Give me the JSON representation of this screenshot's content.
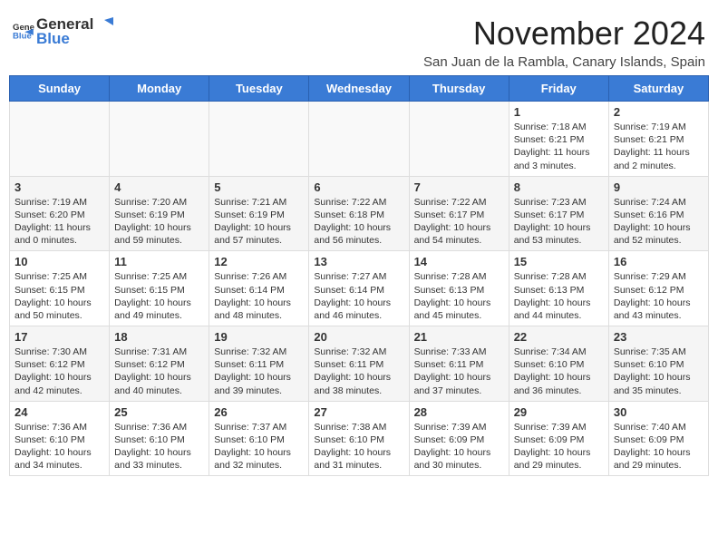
{
  "header": {
    "logo_general": "General",
    "logo_blue": "Blue",
    "month_title": "November 2024",
    "subtitle": "San Juan de la Rambla, Canary Islands, Spain"
  },
  "days_of_week": [
    "Sunday",
    "Monday",
    "Tuesday",
    "Wednesday",
    "Thursday",
    "Friday",
    "Saturday"
  ],
  "weeks": [
    [
      {
        "day": "",
        "info": ""
      },
      {
        "day": "",
        "info": ""
      },
      {
        "day": "",
        "info": ""
      },
      {
        "day": "",
        "info": ""
      },
      {
        "day": "",
        "info": ""
      },
      {
        "day": "1",
        "info": "Sunrise: 7:18 AM\nSunset: 6:21 PM\nDaylight: 11 hours and 3 minutes."
      },
      {
        "day": "2",
        "info": "Sunrise: 7:19 AM\nSunset: 6:21 PM\nDaylight: 11 hours and 2 minutes."
      }
    ],
    [
      {
        "day": "3",
        "info": "Sunrise: 7:19 AM\nSunset: 6:20 PM\nDaylight: 11 hours and 0 minutes."
      },
      {
        "day": "4",
        "info": "Sunrise: 7:20 AM\nSunset: 6:19 PM\nDaylight: 10 hours and 59 minutes."
      },
      {
        "day": "5",
        "info": "Sunrise: 7:21 AM\nSunset: 6:19 PM\nDaylight: 10 hours and 57 minutes."
      },
      {
        "day": "6",
        "info": "Sunrise: 7:22 AM\nSunset: 6:18 PM\nDaylight: 10 hours and 56 minutes."
      },
      {
        "day": "7",
        "info": "Sunrise: 7:22 AM\nSunset: 6:17 PM\nDaylight: 10 hours and 54 minutes."
      },
      {
        "day": "8",
        "info": "Sunrise: 7:23 AM\nSunset: 6:17 PM\nDaylight: 10 hours and 53 minutes."
      },
      {
        "day": "9",
        "info": "Sunrise: 7:24 AM\nSunset: 6:16 PM\nDaylight: 10 hours and 52 minutes."
      }
    ],
    [
      {
        "day": "10",
        "info": "Sunrise: 7:25 AM\nSunset: 6:15 PM\nDaylight: 10 hours and 50 minutes."
      },
      {
        "day": "11",
        "info": "Sunrise: 7:25 AM\nSunset: 6:15 PM\nDaylight: 10 hours and 49 minutes."
      },
      {
        "day": "12",
        "info": "Sunrise: 7:26 AM\nSunset: 6:14 PM\nDaylight: 10 hours and 48 minutes."
      },
      {
        "day": "13",
        "info": "Sunrise: 7:27 AM\nSunset: 6:14 PM\nDaylight: 10 hours and 46 minutes."
      },
      {
        "day": "14",
        "info": "Sunrise: 7:28 AM\nSunset: 6:13 PM\nDaylight: 10 hours and 45 minutes."
      },
      {
        "day": "15",
        "info": "Sunrise: 7:28 AM\nSunset: 6:13 PM\nDaylight: 10 hours and 44 minutes."
      },
      {
        "day": "16",
        "info": "Sunrise: 7:29 AM\nSunset: 6:12 PM\nDaylight: 10 hours and 43 minutes."
      }
    ],
    [
      {
        "day": "17",
        "info": "Sunrise: 7:30 AM\nSunset: 6:12 PM\nDaylight: 10 hours and 42 minutes."
      },
      {
        "day": "18",
        "info": "Sunrise: 7:31 AM\nSunset: 6:12 PM\nDaylight: 10 hours and 40 minutes."
      },
      {
        "day": "19",
        "info": "Sunrise: 7:32 AM\nSunset: 6:11 PM\nDaylight: 10 hours and 39 minutes."
      },
      {
        "day": "20",
        "info": "Sunrise: 7:32 AM\nSunset: 6:11 PM\nDaylight: 10 hours and 38 minutes."
      },
      {
        "day": "21",
        "info": "Sunrise: 7:33 AM\nSunset: 6:11 PM\nDaylight: 10 hours and 37 minutes."
      },
      {
        "day": "22",
        "info": "Sunrise: 7:34 AM\nSunset: 6:10 PM\nDaylight: 10 hours and 36 minutes."
      },
      {
        "day": "23",
        "info": "Sunrise: 7:35 AM\nSunset: 6:10 PM\nDaylight: 10 hours and 35 minutes."
      }
    ],
    [
      {
        "day": "24",
        "info": "Sunrise: 7:36 AM\nSunset: 6:10 PM\nDaylight: 10 hours and 34 minutes."
      },
      {
        "day": "25",
        "info": "Sunrise: 7:36 AM\nSunset: 6:10 PM\nDaylight: 10 hours and 33 minutes."
      },
      {
        "day": "26",
        "info": "Sunrise: 7:37 AM\nSunset: 6:10 PM\nDaylight: 10 hours and 32 minutes."
      },
      {
        "day": "27",
        "info": "Sunrise: 7:38 AM\nSunset: 6:10 PM\nDaylight: 10 hours and 31 minutes."
      },
      {
        "day": "28",
        "info": "Sunrise: 7:39 AM\nSunset: 6:09 PM\nDaylight: 10 hours and 30 minutes."
      },
      {
        "day": "29",
        "info": "Sunrise: 7:39 AM\nSunset: 6:09 PM\nDaylight: 10 hours and 29 minutes."
      },
      {
        "day": "30",
        "info": "Sunrise: 7:40 AM\nSunset: 6:09 PM\nDaylight: 10 hours and 29 minutes."
      }
    ]
  ]
}
